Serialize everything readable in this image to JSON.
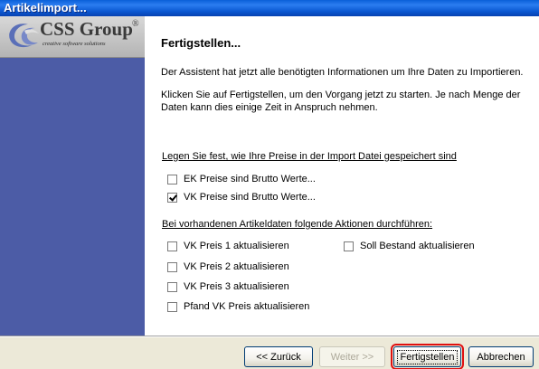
{
  "window": {
    "title": "Artikelimport..."
  },
  "logo": {
    "name": "CSS Group",
    "registered": "®",
    "tagline": "creative software solutions"
  },
  "main": {
    "heading": "Fertigstellen...",
    "paragraph1": "Der Assistent hat jetzt alle benötigten Informationen um Ihre Daten zu Importieren.",
    "paragraph2": "Klicken Sie auf Fertigstellen, um den Vorgang jetzt zu starten. Je nach Menge der Daten kann dies einige Zeit in Anspruch nehmen."
  },
  "prices": {
    "label": "Legen Sie fest, wie Ihre Preise in der Import Datei gespeichert sind",
    "options": [
      {
        "label": "EK Preise sind Brutto Werte...",
        "checked": false
      },
      {
        "label": "VK Preise sind Brutto Werte...",
        "checked": true
      }
    ]
  },
  "actions": {
    "label": "Bei vorhandenen Artikeldaten folgende Aktionen durchführen:",
    "options": [
      {
        "label": "VK Preis 1 aktualisieren",
        "checked": false
      },
      {
        "label": "VK Preis 2 aktualisieren",
        "checked": false
      },
      {
        "label": "VK Preis 3 aktualisieren",
        "checked": false
      },
      {
        "label": "Pfand VK Preis aktualisieren",
        "checked": false
      },
      {
        "label": "Soll Bestand aktualisieren",
        "checked": false
      }
    ]
  },
  "buttons": {
    "back": "<< Zurück",
    "next": "Weiter >>",
    "finish": "Fertigstellen",
    "cancel": "Abbrechen"
  },
  "colors": {
    "sidebar": "#4c5ca6",
    "titlebar": "#0b58d2",
    "focus_highlight": "#e01010"
  }
}
